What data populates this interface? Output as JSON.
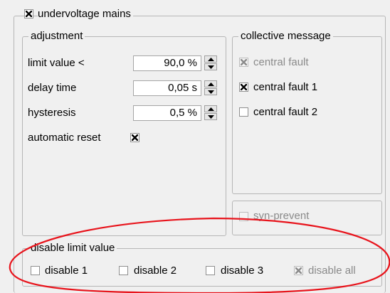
{
  "main": {
    "label": "undervoltage mains",
    "checked": true
  },
  "adjustment": {
    "title": "adjustment",
    "limit_label": "limit value <",
    "limit_value": "90,0 %",
    "delay_label": "delay time",
    "delay_value": "0,05 s",
    "hysteresis_label": "hysteresis",
    "hysteresis_value": "0,5 %",
    "auto_reset_label": "automatic reset",
    "auto_reset_checked": true
  },
  "collective": {
    "title": "collective message",
    "items": [
      {
        "label": "central fault",
        "checked": true,
        "disabled": true
      },
      {
        "label": "central fault 1",
        "checked": true,
        "disabled": false
      },
      {
        "label": "central fault 2",
        "checked": false,
        "disabled": false
      }
    ]
  },
  "syn_prevent": {
    "label": "syn-prevent",
    "checked": false,
    "disabled": true
  },
  "disable_limit": {
    "title": "disable limit value",
    "items": [
      {
        "label": "disable 1",
        "checked": false,
        "disabled": false
      },
      {
        "label": "disable 2",
        "checked": false,
        "disabled": false
      },
      {
        "label": "disable 3",
        "checked": false,
        "disabled": false
      },
      {
        "label": "disable all",
        "checked": true,
        "disabled": true
      }
    ]
  },
  "colors": {
    "annotation": "#e8141c",
    "check": "#000000",
    "check_disabled": "#8a8a8a"
  }
}
